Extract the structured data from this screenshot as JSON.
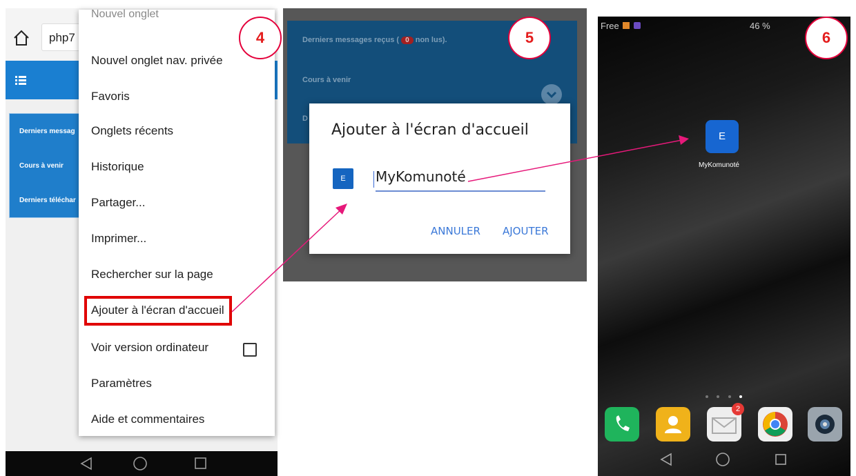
{
  "steps": [
    "4",
    "5",
    "6"
  ],
  "browser": {
    "url_text": "php7"
  },
  "background_cards": [
    "Derniers messag",
    "Cours à venir",
    "Derniers téléchar"
  ],
  "menu": {
    "faded_item": "Nouvel onglet",
    "items": [
      "Nouvel onglet nav. privée",
      "Favoris",
      "Onglets récents",
      "Historique",
      "Partager...",
      "Imprimer...",
      "Rechercher sur la page",
      "Ajouter à l'écran d'accueil",
      "Voir version ordinateur",
      "Paramètres",
      "Aide et commentaires"
    ],
    "desktop_checked": false
  },
  "dialog_bg": {
    "row1_prefix": "Derniers messages reçus (",
    "unread_count": "0",
    "row1_suffix": "non lus).",
    "row2": "Cours à venir",
    "row3": "D"
  },
  "dialog": {
    "title": "Ajouter à l'écran d'accueil",
    "icon_letter": "E",
    "input_value": "MyKomunoté",
    "cancel": "ANNULER",
    "confirm": "AJOUTER"
  },
  "homescreen": {
    "carrier": "Free",
    "battery": "46 %",
    "app_letter": "E",
    "app_label": "MyKomunoté",
    "mail_badge": "2",
    "page_count": 4,
    "active_page": 4
  },
  "colors": {
    "highlight": "#e00000",
    "arrow": "#e6197a",
    "browser_blue": "#1a7fd1",
    "app_blue": "#1766d1"
  }
}
